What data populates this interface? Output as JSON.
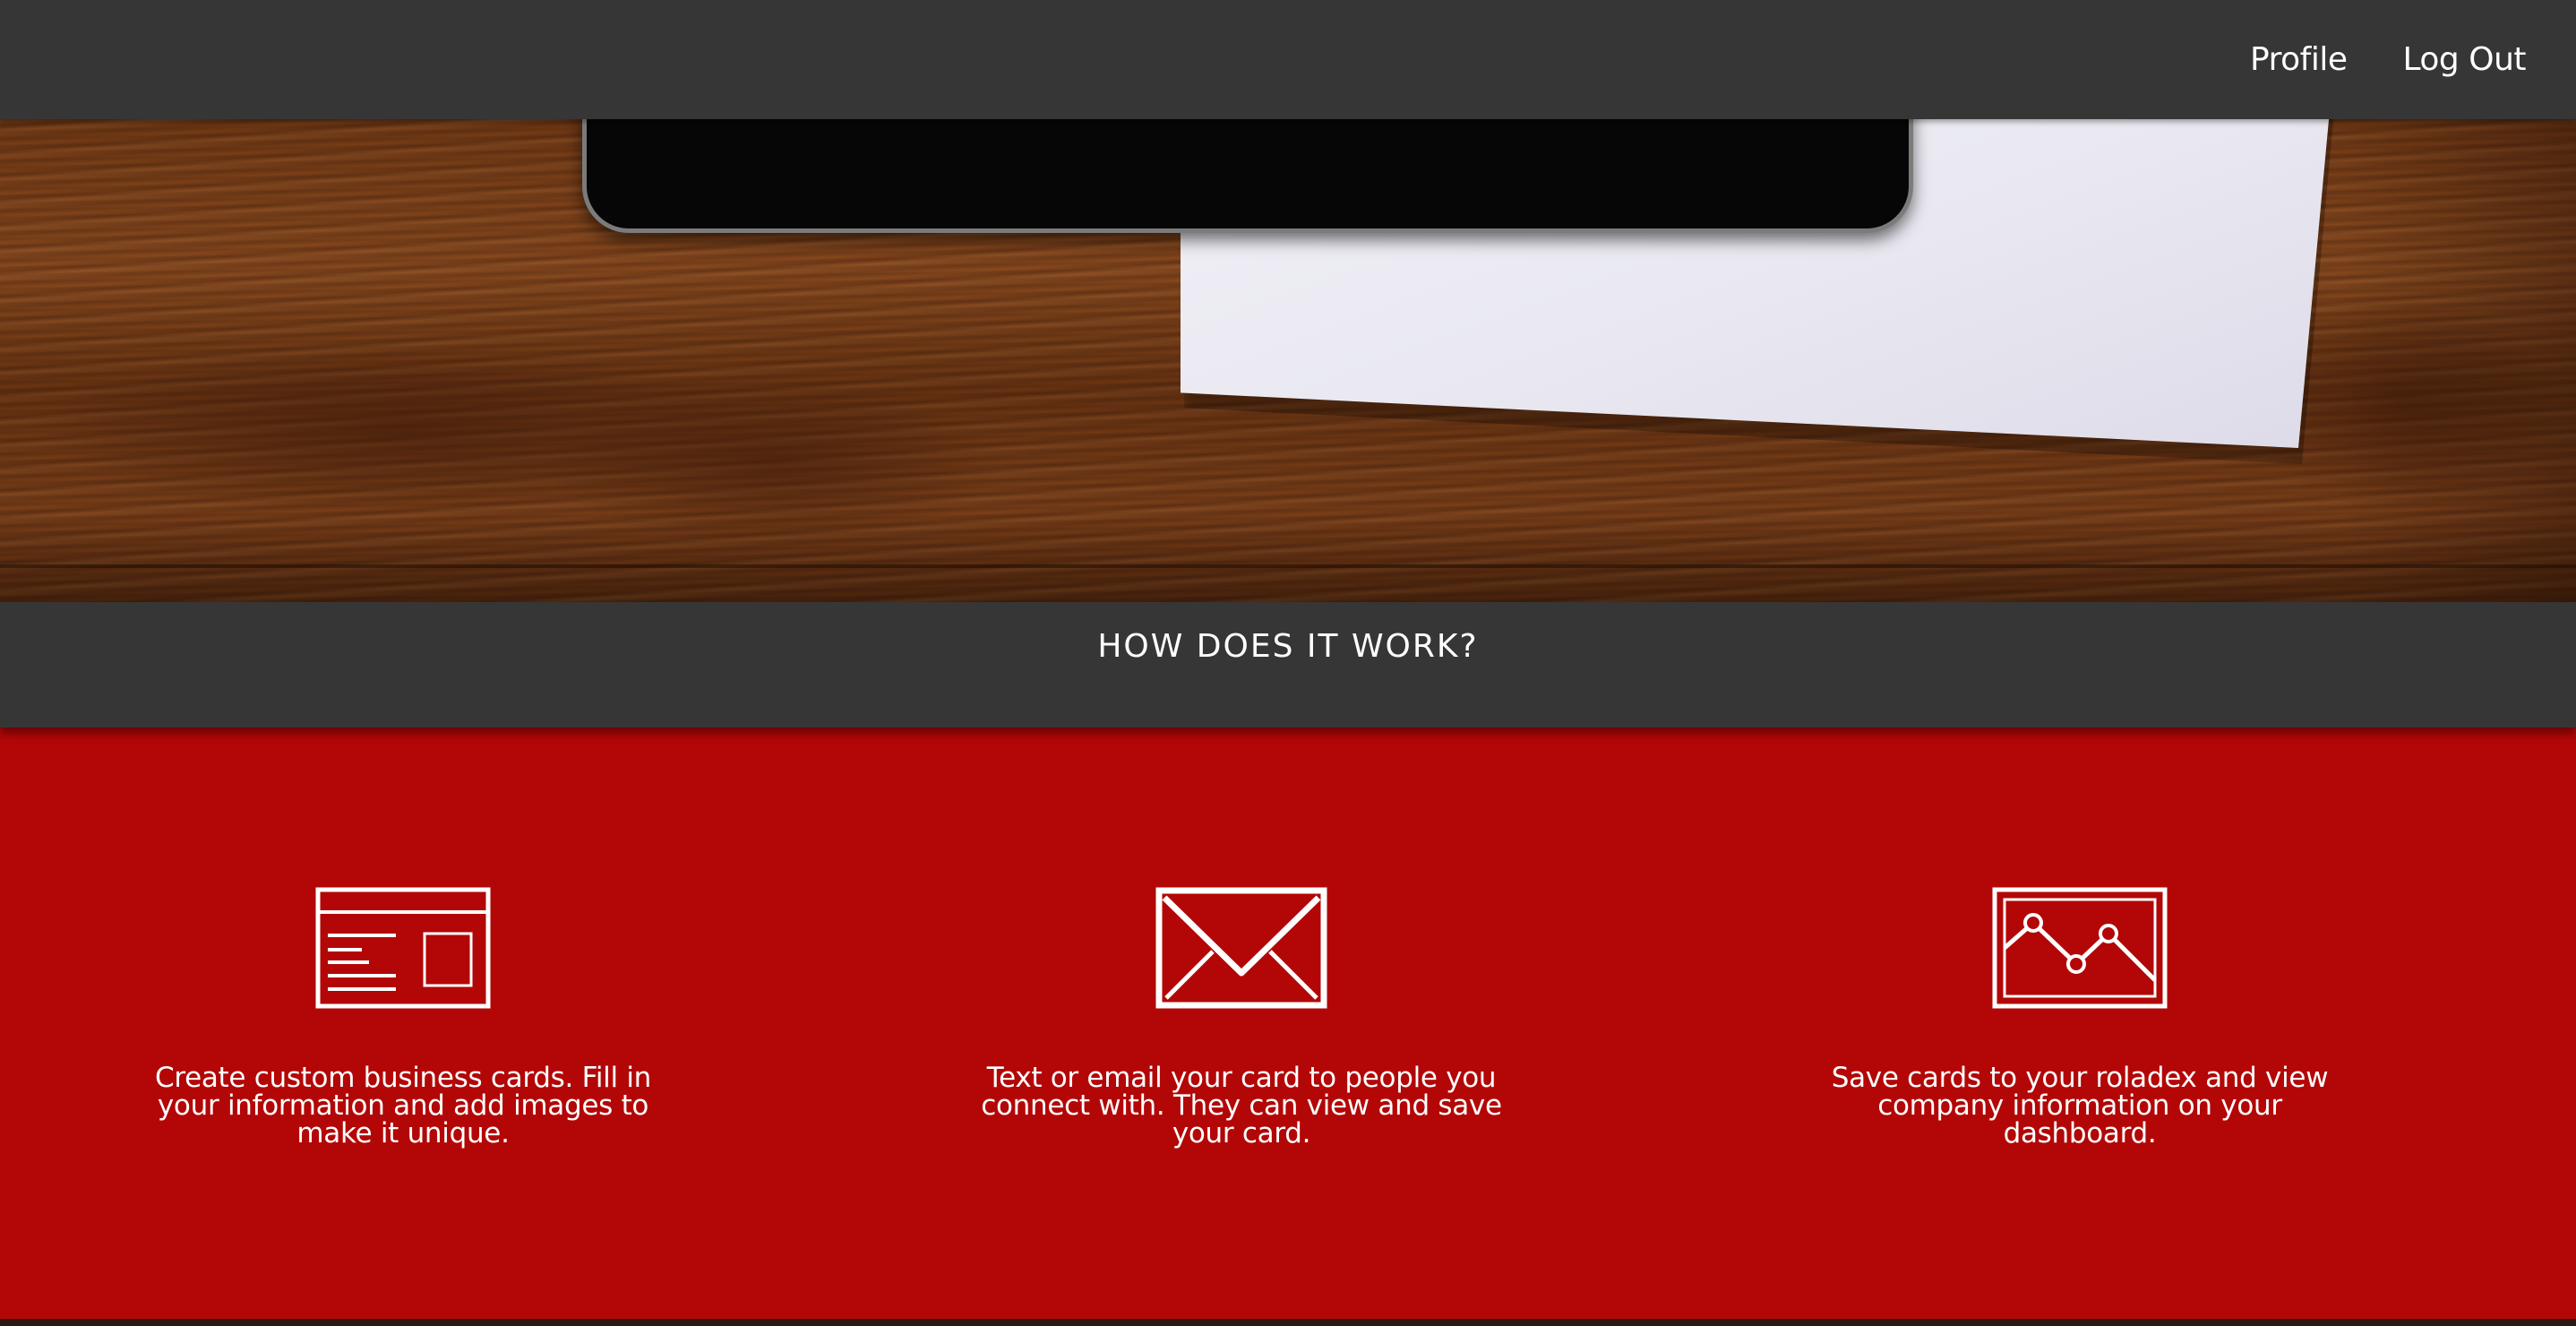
{
  "nav": {
    "profile_label": "Profile",
    "logout_label": "Log Out"
  },
  "hero": {
    "image": "wood-desk-with-tablet-and-blank-card"
  },
  "how_section": {
    "title": "HOW DOES IT WORK?"
  },
  "features": [
    {
      "icon": "business-card-icon",
      "text": "Create custom business cards. Fill in your information and add images to make it unique."
    },
    {
      "icon": "envelope-icon",
      "text": "Text or email your card to people you connect with. They can view and save your card."
    },
    {
      "icon": "line-chart-icon",
      "text": "Save cards to your roladex and view company information on your dashboard."
    }
  ],
  "colors": {
    "nav_bg": "#363636",
    "accent_red": "#b30707",
    "text": "#ffffff"
  }
}
